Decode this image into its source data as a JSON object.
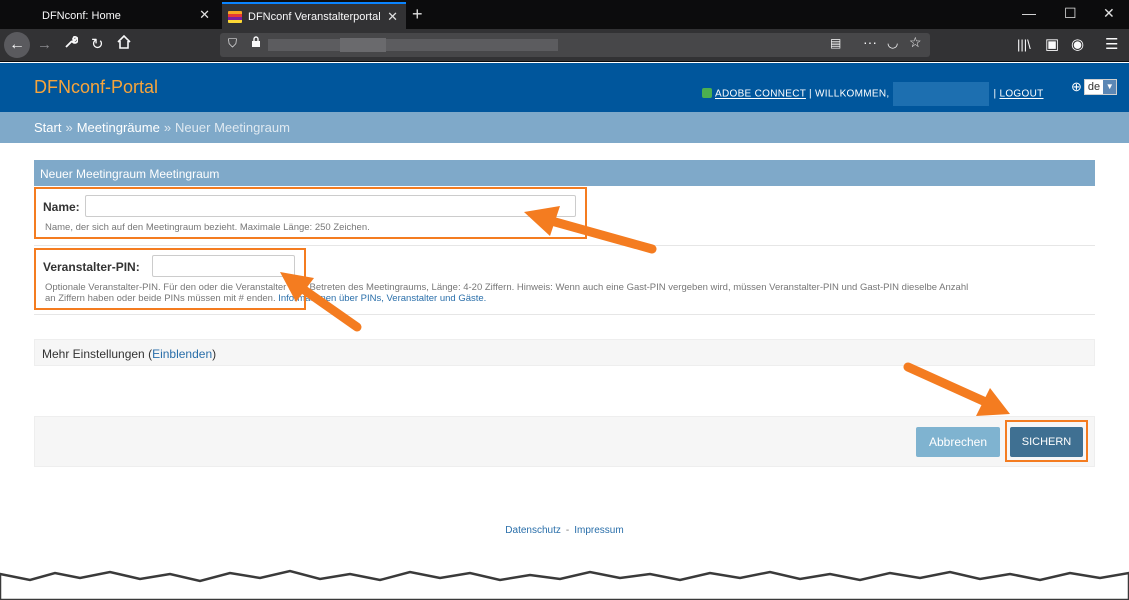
{
  "browser": {
    "tabs": [
      {
        "label": "DFNconf: Home"
      },
      {
        "label": "DFNconf Veranstalterportal"
      }
    ],
    "new_tab_label": "+",
    "window_controls": {
      "minimize": "—",
      "maximize": "☐",
      "close": "✕"
    }
  },
  "header": {
    "title": "DFNconf-Portal",
    "adobe_connect": "ADOBE CONNECT",
    "separator": "|",
    "welcome": "WILLKOMMEN,",
    "logout": "LOGOUT",
    "language": "de"
  },
  "breadcrumb": {
    "items": [
      "Start",
      "Meetingräume",
      "Neuer Meetingraum"
    ],
    "separator": "»"
  },
  "form": {
    "panel_title": "Neuer Meetingraum Meetingraum",
    "name_label": "Name:",
    "name_value": "",
    "name_help": "Name, der sich auf den Meetingraum bezieht. Maximale Länge: 250 Zeichen.",
    "pin_label": "Veranstalter-PIN:",
    "pin_value": "",
    "pin_help_1": "Optionale Veranstalter-PIN. Für den oder die Veranstalter zum Betreten des Meetingraums, Länge: 4-20 Ziffern. Hinweis: Wenn auch eine Gast-PIN vergeben wird, müssen Veranstalter-PIN und Gast-PIN dieselbe Anzahl",
    "pin_help_2": "an Ziffern haben oder beide PINs müssen mit # enden.",
    "pin_help_link": "Informationen über PINs, Veranstalter und Gäste.",
    "more_label": "Mehr Einstellungen",
    "more_paren_open": "(",
    "more_link": "Einblenden",
    "more_paren_close": ")",
    "cancel_label": "Abbrechen",
    "save_label": "SICHERN"
  },
  "footer": {
    "privacy": "Datenschutz",
    "dash": "-",
    "imprint": "Impressum"
  },
  "colors": {
    "header_blue": "#00569c",
    "title_orange": "#f7a43b",
    "breadcrumb_blue": "#7fa9c9",
    "annotation_orange": "#f47c20",
    "save_button": "#3f7092",
    "cancel_button": "#7fb3d0"
  },
  "icons": {
    "back": "back-arrow-icon",
    "forward": "forward-arrow-icon",
    "tools": "wrench-icon",
    "reload": "reload-icon",
    "home": "home-icon",
    "shield": "shield-icon",
    "lock": "lock-icon",
    "reader": "reader-view-icon",
    "more": "more-icon",
    "pocket": "pocket-icon",
    "bookmark": "star-icon",
    "library": "library-icon",
    "sidebar": "sidebar-icon",
    "account": "account-icon",
    "menu": "hamburger-menu-icon",
    "globe": "globe-icon"
  }
}
